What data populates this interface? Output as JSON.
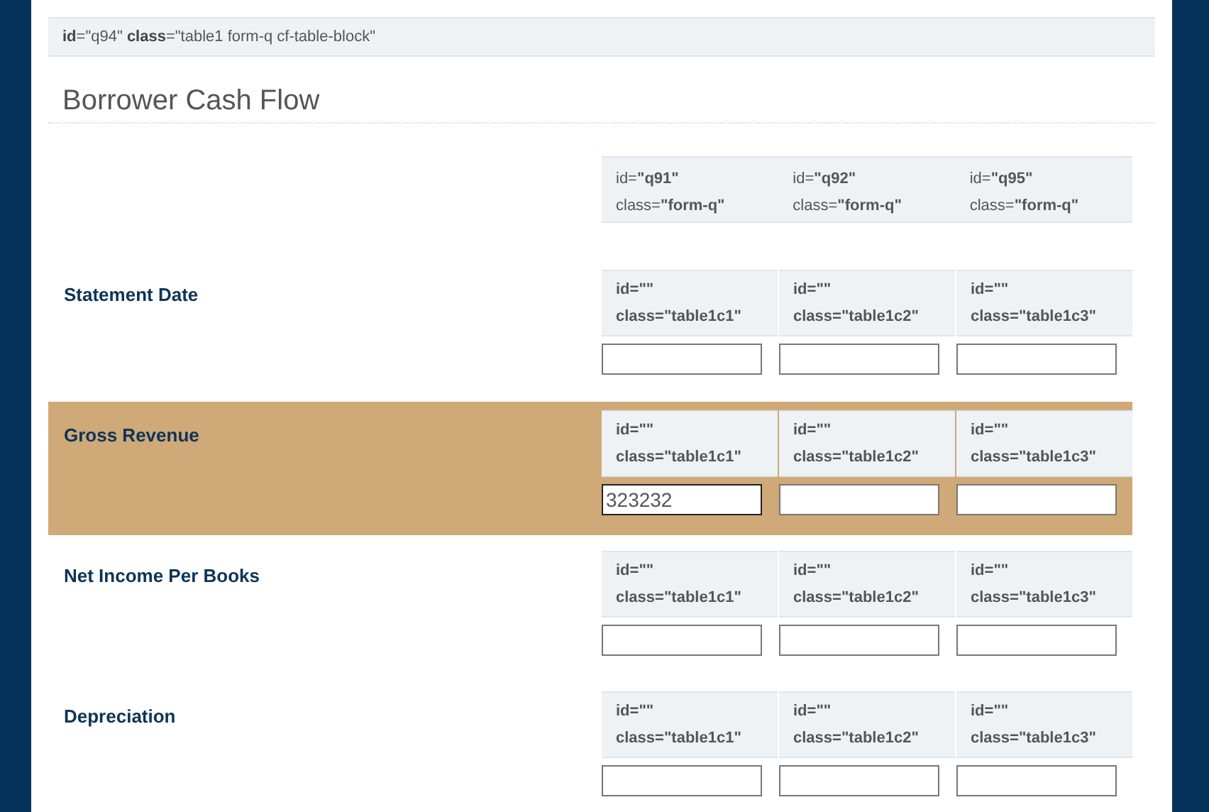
{
  "block_label": "**id**=\"q94\" **class**=\"table1 form-q cf-table-block\"",
  "title": "Borrower Cash Flow",
  "columns": [
    {
      "id": "id=**\"q91\"**",
      "class": "class=**\"form-q\"**"
    },
    {
      "id": "id=**\"q92\"**",
      "class": "class=**\"form-q\"**"
    },
    {
      "id": "id=**\"q95\"**",
      "class": "class=**\"form-q\"**"
    }
  ],
  "rows": [
    {
      "label": "Statement Date",
      "highlighted": false,
      "cells": [
        {
          "id": "id=\"\"",
          "class": "class=\"table1c1\""
        },
        {
          "id": "id=\"\"",
          "class": "class=\"table1c2\""
        },
        {
          "id": "id=\"\"",
          "class": "class=\"table1c3\""
        }
      ]
    },
    {
      "label": "Gross Revenue",
      "highlighted": true,
      "cells": [
        {
          "id": "id=\"\"",
          "class": "class=\"table1c1\"",
          "value": "323232"
        },
        {
          "id": "id=\"\"",
          "class": "class=\"table1c2\""
        },
        {
          "id": "id=\"\"",
          "class": "class=\"table1c3\""
        }
      ]
    },
    {
      "label": "Net Income Per Books",
      "highlighted": false,
      "cells": [
        {
          "id": "id=\"\"",
          "class": "class=\"table1c1\""
        },
        {
          "id": "id=\"\"",
          "class": "class=\"table1c2\""
        },
        {
          "id": "id=\"\"",
          "class": "class=\"table1c3\""
        }
      ]
    },
    {
      "label": "Depreciation",
      "highlighted": false,
      "cells": [
        {
          "id": "id=\"\"",
          "class": "class=\"table1c1\""
        },
        {
          "id": "id=\"\"",
          "class": "class=\"table1c2\""
        },
        {
          "id": "id=\"\"",
          "class": "class=\"table1c3\""
        }
      ]
    }
  ]
}
